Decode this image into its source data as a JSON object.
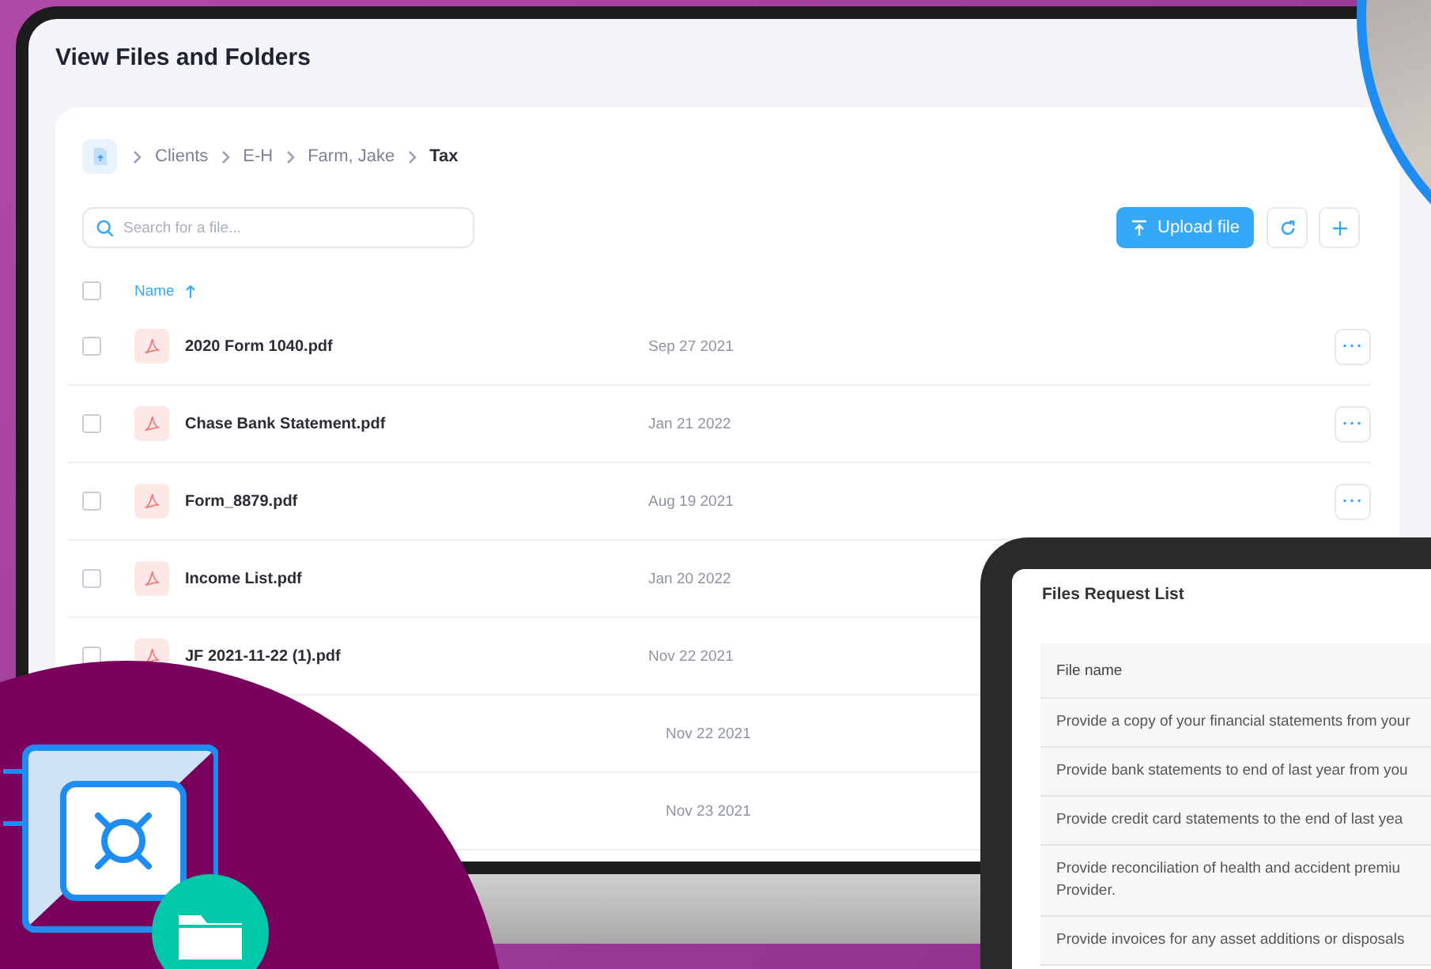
{
  "laptop": {
    "title": "View Files and Folders",
    "breadcrumb": [
      {
        "label": "Clients",
        "current": false
      },
      {
        "label": "E-H",
        "current": false
      },
      {
        "label": "Farm, Jake",
        "current": false
      },
      {
        "label": "Tax",
        "current": true
      }
    ],
    "search": {
      "placeholder": "Search for a file..."
    },
    "upload_button": "Upload file",
    "select_all_checked": false,
    "columns": [
      {
        "label": "Name"
      }
    ],
    "rows": [
      {
        "name": "2020 Form 1040.pdf",
        "date": "Sep 27 2021",
        "checked": false,
        "menu": "•••"
      },
      {
        "name": "Chase Bank Statement.pdf",
        "date": "Jan 21 2022",
        "checked": false,
        "menu": "•••"
      },
      {
        "name": "Form_8879.pdf",
        "date": "Aug 19 2021",
        "checked": false,
        "menu": "•••"
      },
      {
        "name": "Income List.pdf",
        "date": "Jan 20 2022",
        "checked": false
      },
      {
        "name": "JF 2021-11-22 (1).pdf",
        "date": "Nov 22 2021",
        "checked": false
      },
      {
        "date": "Nov 22 2021"
      },
      {
        "date": "Nov 23 2021"
      }
    ]
  },
  "tablet": {
    "title": "Files Request List",
    "columns": [
      "File name"
    ],
    "rows": [
      "Provide a copy of your financial statements from your",
      "Provide bank statements to end of last year from you",
      "Provide credit card statements to the end of last yea",
      "Provide reconciliation of health and accident premiu\nProvider.",
      "Provide invoices for any asset additions or disposals"
    ]
  }
}
